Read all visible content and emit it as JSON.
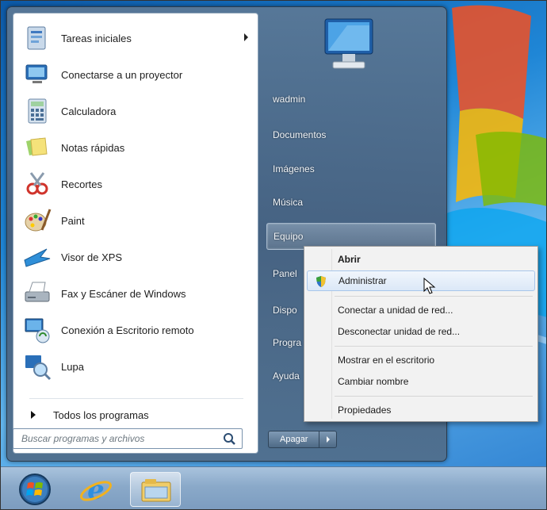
{
  "start_menu": {
    "programs": [
      {
        "label": "Tareas iniciales",
        "icon": "getting-started-icon",
        "has_submenu": true
      },
      {
        "label": "Conectarse a un proyector",
        "icon": "projector-icon",
        "has_submenu": false
      },
      {
        "label": "Calculadora",
        "icon": "calculator-icon",
        "has_submenu": false
      },
      {
        "label": "Notas rápidas",
        "icon": "sticky-notes-icon",
        "has_submenu": false
      },
      {
        "label": "Recortes",
        "icon": "snipping-tool-icon",
        "has_submenu": false
      },
      {
        "label": "Paint",
        "icon": "paint-icon",
        "has_submenu": false
      },
      {
        "label": "Visor de XPS",
        "icon": "xps-viewer-icon",
        "has_submenu": false
      },
      {
        "label": "Fax y Escáner de Windows",
        "icon": "fax-scanner-icon",
        "has_submenu": false
      },
      {
        "label": "Conexión a Escritorio remoto",
        "icon": "remote-desktop-icon",
        "has_submenu": false
      },
      {
        "label": "Lupa",
        "icon": "magnifier-icon",
        "has_submenu": false
      }
    ],
    "all_programs": "Todos los programas",
    "search_placeholder": "Buscar programas y archivos",
    "right_links": [
      {
        "label": "wadmin"
      },
      {
        "label": "Documentos"
      },
      {
        "label": "Imágenes"
      },
      {
        "label": "Música"
      },
      {
        "label": "Equipo"
      },
      {
        "label": "Panel"
      },
      {
        "label": "Dispo"
      },
      {
        "label": "Progra"
      },
      {
        "label": "Ayuda"
      }
    ],
    "shutdown_label": "Apagar"
  },
  "context_menu": {
    "items": [
      {
        "label": "Abrir",
        "bold": true
      },
      {
        "label": "Administrar",
        "icon": "shield-icon"
      },
      {
        "label": "Conectar a unidad de red..."
      },
      {
        "label": "Desconectar unidad de red..."
      },
      {
        "label": "Mostrar en el escritorio"
      },
      {
        "label": "Cambiar nombre"
      },
      {
        "label": "Propiedades"
      }
    ],
    "hovered": "Administrar"
  },
  "taskbar": {
    "items": [
      "start-orb-icon",
      "internet-explorer-icon",
      "windows-explorer-icon"
    ]
  },
  "colors": {
    "menu_frame": "#55728f",
    "context_hover": "#dbe8f7",
    "taskbar": "#8aa9c9"
  }
}
